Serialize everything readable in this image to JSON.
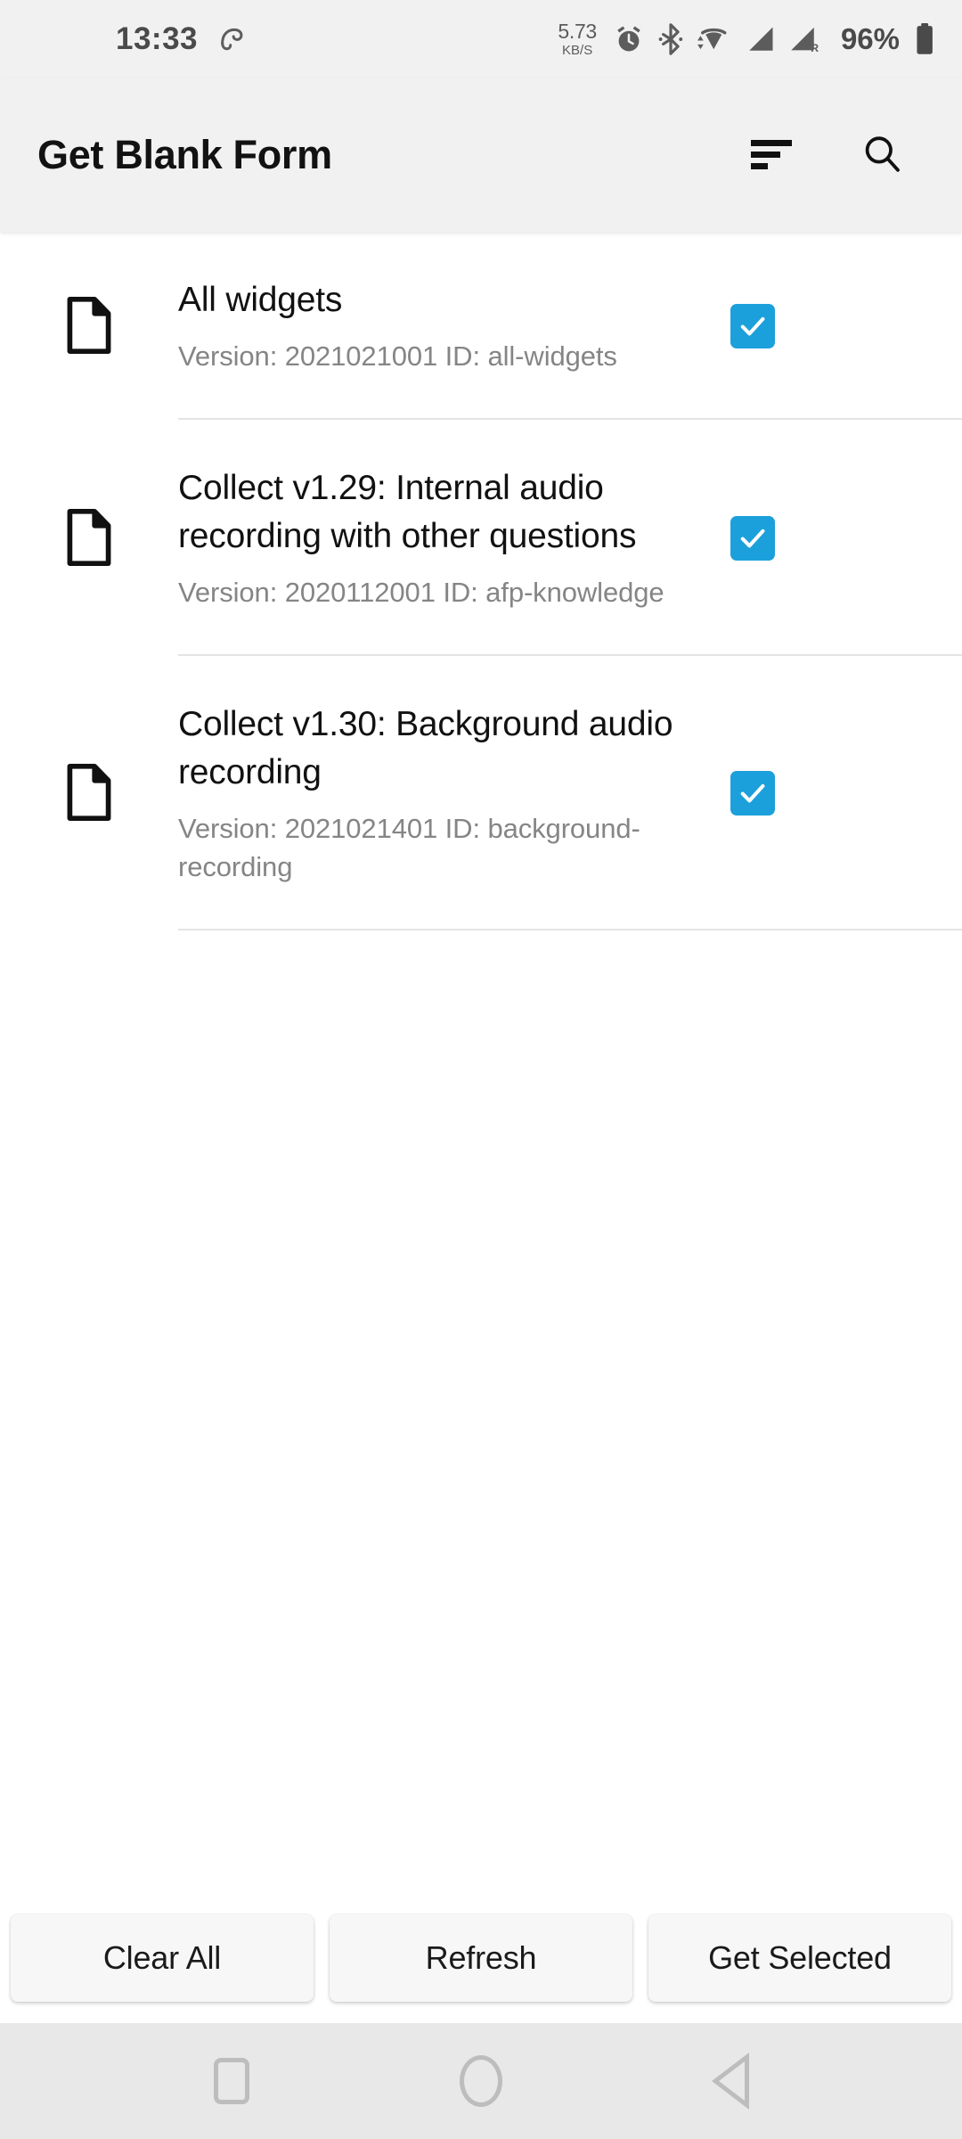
{
  "status_bar": {
    "clock": "13:33",
    "shield_icon": "antivirus-umbrella-icon",
    "network_speed_value": "5.73",
    "network_speed_unit": "KB/S",
    "icons": [
      "alarm-icon",
      "bluetooth-icon",
      "wifi-icon",
      "signal-icon",
      "signal-roaming-icon"
    ],
    "roaming_label": "R",
    "battery_percent": "96%",
    "battery_icon": "battery-full-icon"
  },
  "app_bar": {
    "title": "Get Blank Form",
    "sort_icon": "sort-icon",
    "search_icon": "search-icon"
  },
  "colors": {
    "checkbox_blue": "#1CA0DB",
    "status_bar_bg": "#f1f1f1",
    "nav_bar_bg": "#e8e8e8",
    "divider": "#e4e4e4",
    "subtitle_text": "#858585"
  },
  "forms": [
    {
      "title": "All widgets",
      "subtitle": "Version: 2021021001 ID: all-widgets",
      "checked": true,
      "doc_icon": "document-icon"
    },
    {
      "title": "Collect v1.29: Internal audio recording with other questions",
      "subtitle": "Version: 2020112001 ID: afp-knowledge",
      "checked": true,
      "doc_icon": "document-icon"
    },
    {
      "title": "Collect v1.30: Background audio recording",
      "subtitle": "Version: 2021021401 ID: background-recording",
      "checked": true,
      "doc_icon": "document-icon"
    }
  ],
  "buttons": {
    "clear_all": "Clear All",
    "refresh": "Refresh",
    "get_selected": "Get Selected"
  },
  "nav_bar": {
    "recents": "recents-square-icon",
    "home": "home-circle-icon",
    "back": "back-triangle-icon"
  }
}
